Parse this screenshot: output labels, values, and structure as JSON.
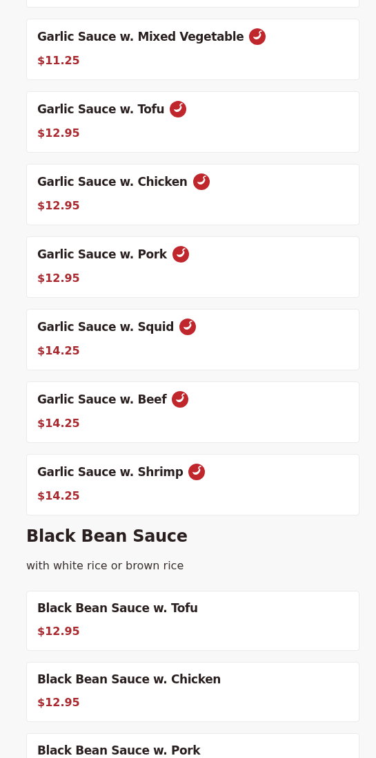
{
  "sections": [
    {
      "items": [
        {
          "name": "Garlic Sauce w. Mixed Vegetable",
          "price": "$11.25",
          "spicy": true
        },
        {
          "name": "Garlic Sauce w. Tofu",
          "price": "$12.95",
          "spicy": true
        },
        {
          "name": "Garlic Sauce w. Chicken",
          "price": "$12.95",
          "spicy": true
        },
        {
          "name": "Garlic Sauce w. Pork",
          "price": "$12.95",
          "spicy": true
        },
        {
          "name": "Garlic Sauce w. Squid",
          "price": "$14.25",
          "spicy": true
        },
        {
          "name": "Garlic Sauce w. Beef",
          "price": "$14.25",
          "spicy": true
        },
        {
          "name": "Garlic Sauce w. Shrimp",
          "price": "$14.25",
          "spicy": true
        }
      ]
    },
    {
      "title": "Black Bean Sauce",
      "subtitle": "with white rice or brown rice",
      "items": [
        {
          "name": "Black Bean Sauce w. Tofu",
          "price": "$12.95",
          "spicy": false
        },
        {
          "name": "Black Bean Sauce w. Chicken",
          "price": "$12.95",
          "spicy": false
        },
        {
          "name": "Black Bean Sauce w. Pork",
          "spicy": false
        }
      ]
    }
  ]
}
